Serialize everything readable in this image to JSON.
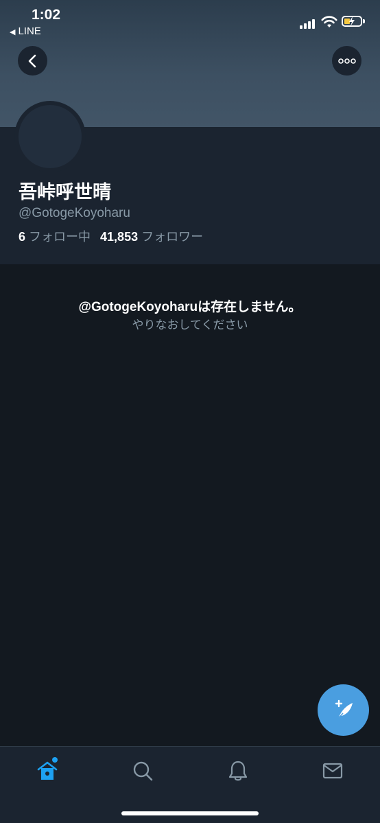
{
  "status_bar": {
    "time": "1:02",
    "back_app_label": "LINE",
    "signal_icon": "cellular-signal-icon",
    "wifi_icon": "wifi-icon",
    "battery_icon": "battery-charging-icon",
    "battery_level": 0.25,
    "battery_color": "#f5c842"
  },
  "header": {
    "back_icon": "chevron-left-icon",
    "more_icon": "ellipsis-icon"
  },
  "profile": {
    "display_name": "吾峠呼世晴",
    "handle": "@GotogeKoyoharu",
    "following_count": "6",
    "following_label": "フォロー中",
    "followers_count": "41,853",
    "followers_label": "フォロワー"
  },
  "message": {
    "title": "@GotogeKoyoharuは存在しません。",
    "subtitle": "やりなおしてください"
  },
  "fab": {
    "icon": "compose-tweet-icon",
    "color": "#1da1f2"
  },
  "tab_bar": {
    "tabs": [
      {
        "name": "home",
        "icon": "home-icon",
        "active": true
      },
      {
        "name": "search",
        "icon": "search-icon",
        "active": false
      },
      {
        "name": "notifications",
        "icon": "bell-icon",
        "active": false
      },
      {
        "name": "messages",
        "icon": "envelope-icon",
        "active": false
      }
    ],
    "active_color": "#1da1f2",
    "inactive_color": "#8899a6"
  }
}
